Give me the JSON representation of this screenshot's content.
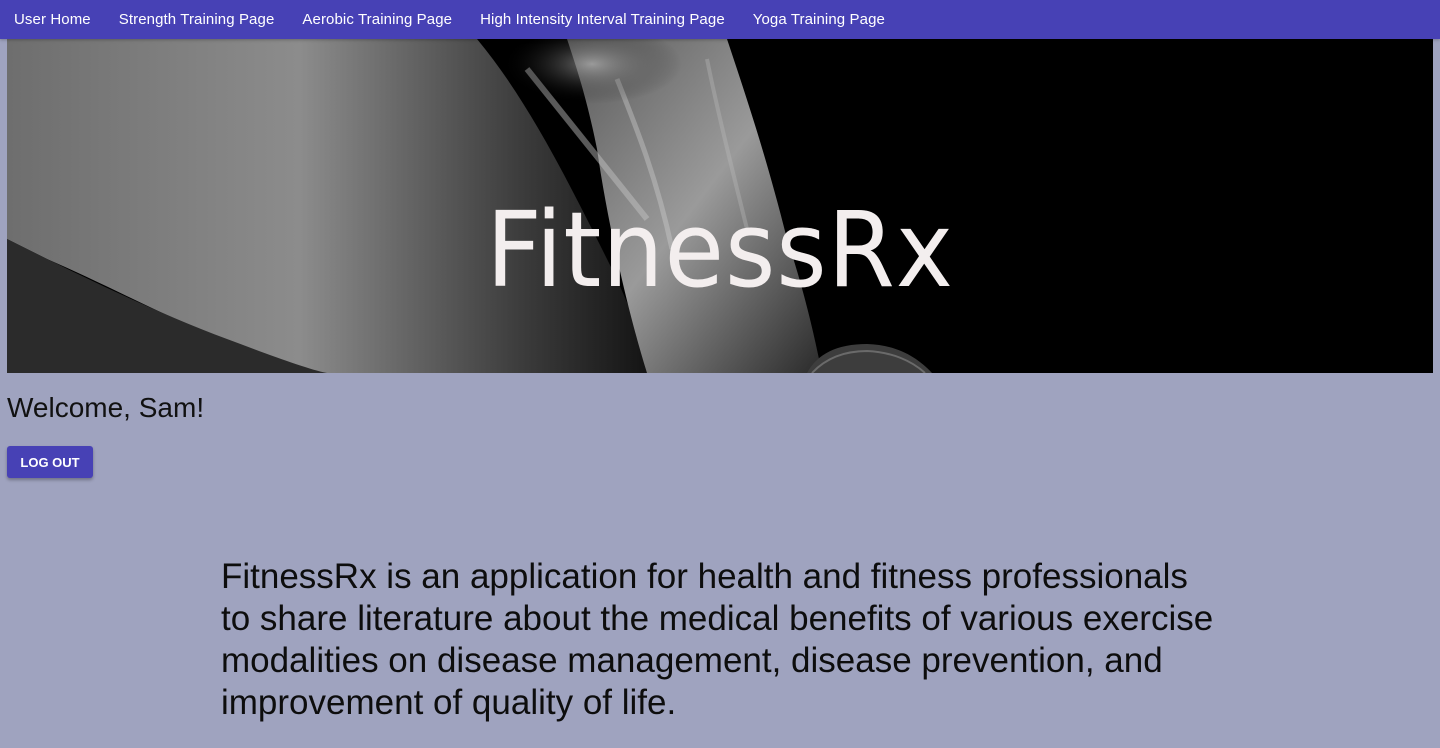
{
  "nav": {
    "items": [
      {
        "label": "User Home"
      },
      {
        "label": "Strength Training Page"
      },
      {
        "label": "Aerobic Training Page"
      },
      {
        "label": "High Intensity Interval Training Page"
      },
      {
        "label": "Yoga Training Page"
      }
    ]
  },
  "hero": {
    "title": "FitnessRx"
  },
  "user": {
    "welcome": "Welcome, Sam!",
    "logout_label": "LOG OUT"
  },
  "intro": {
    "text": "FitnessRx is an application for health and fitness professionals to share literature about the medical benefits of various exercise modalities on disease management, disease prevention, and improvement of quality of life."
  },
  "colors": {
    "accent": "#4741b5",
    "page_background": "#9fa3bf",
    "hero_background": "#000000"
  }
}
